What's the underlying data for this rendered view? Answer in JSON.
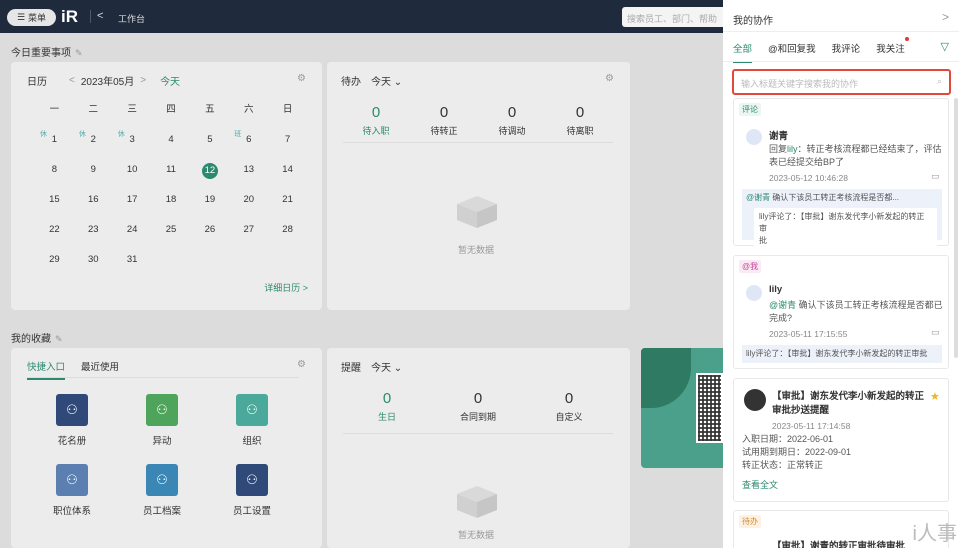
{
  "topbar": {
    "menu_label": "菜单",
    "logo": "iR",
    "back": "<",
    "title": "工作台",
    "search_placeholder": "搜索员工、部门、帮助"
  },
  "today": {
    "title": "今日重要事项"
  },
  "calendar": {
    "label": "日历",
    "prev": "<",
    "month": "2023年05月",
    "next": ">",
    "today": "今天",
    "weekdays": [
      "一",
      "二",
      "三",
      "四",
      "五",
      "六",
      "日"
    ],
    "days": [
      [
        "1",
        "2",
        "3",
        "4",
        "5",
        "6",
        "7"
      ],
      [
        "8",
        "9",
        "10",
        "11",
        "12",
        "13",
        "14"
      ],
      [
        "15",
        "16",
        "17",
        "18",
        "19",
        "20",
        "21"
      ],
      [
        "22",
        "23",
        "24",
        "25",
        "26",
        "27",
        "28"
      ],
      [
        "29",
        "30",
        "31",
        "",
        "",
        "",
        ""
      ]
    ],
    "tags": {
      "1": "休",
      "2": "休",
      "3": "休",
      "6": "班"
    },
    "selected": "12",
    "detail": "详细日历 >"
  },
  "todo": {
    "label": "待办",
    "filter": "今天",
    "stats": [
      {
        "v": "0",
        "l": "待入职"
      },
      {
        "v": "0",
        "l": "待转正"
      },
      {
        "v": "0",
        "l": "待调动"
      },
      {
        "v": "0",
        "l": "待离职"
      }
    ],
    "empty": "暂无数据"
  },
  "fav": {
    "title": "我的收藏",
    "tab1": "快捷入口",
    "tab2": "最近使用",
    "apps": [
      {
        "l": "花名册",
        "c": "#2f4a78"
      },
      {
        "l": "异动",
        "c": "#4fa45b"
      },
      {
        "l": "组织",
        "c": "#4aa99a"
      },
      {
        "l": "职位体系",
        "c": "#5a7fb0"
      },
      {
        "l": "员工档案",
        "c": "#3a86b5"
      },
      {
        "l": "员工设置",
        "c": "#2f4a78"
      }
    ]
  },
  "remind": {
    "label": "提醒",
    "filter": "今天",
    "stats": [
      {
        "v": "0",
        "l": "生日"
      },
      {
        "v": "0",
        "l": "合同到期"
      },
      {
        "v": "0",
        "l": "自定义"
      }
    ],
    "empty": "暂无数据"
  },
  "panel": {
    "title": "我的协作",
    "close": ">",
    "tabs": [
      "全部",
      "@和回复我",
      "我评论",
      "我关注"
    ],
    "search_placeholder": "输入标题关键字搜索我的协作",
    "item1": {
      "badge": "评论",
      "name": "谢青",
      "reply_prefix": "回复",
      "reply_user": "lily",
      "reply_rest": "：转正考核流程都已经结束了，评估",
      "reply_line2": "表已经提交给BP了",
      "time": "2023-05-12 10:46:28",
      "q1_user": "@谢青",
      "q1_text": " 确认下该员工转正考核流程是否都...",
      "q2_user": "lily评论了：",
      "q2_text": "【审批】谢东发代李小新发起的转正审",
      "q2_line2": "批"
    },
    "item2": {
      "badge": "@我",
      "name": "lily",
      "mention": "@谢青",
      "text": " 确认下该员工转正考核流程是否都已",
      "text2": "完成?",
      "time": "2023-05-11 17:15:55",
      "q_user": "lily评论了：",
      "q_text": "【审批】谢东发代李小新发起的转正审批"
    },
    "item3": {
      "title": "【审批】谢东发代李小新发起的转正",
      "title2": "审批抄送提醒",
      "time": "2023-05-11 17:14:58",
      "f1": "入职日期：",
      "v1": "2022-06-01",
      "f2": "试用期到期日：",
      "v2": "2022-09-01",
      "f3": "转正状态：",
      "v3": "正常转正",
      "more": "查看全文"
    },
    "item4": {
      "badge": "待办",
      "title": "【审批】谢青的转正审批待审批"
    }
  },
  "watermark": "i人事"
}
